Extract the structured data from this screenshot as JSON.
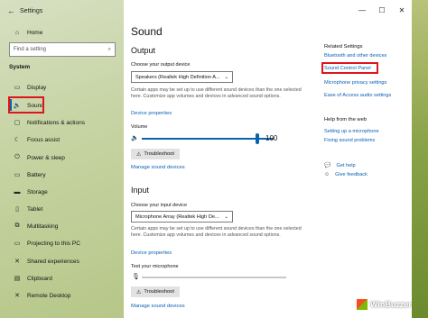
{
  "titlebar": {
    "back": "←",
    "title": "Settings"
  },
  "sidebar": {
    "home": "Home",
    "search_placeholder": "Find a setting",
    "section": "System",
    "items": [
      {
        "icon": "display-icon",
        "glyph": "▭",
        "label": "Display"
      },
      {
        "icon": "speaker-icon",
        "glyph": "🔈",
        "label": "Sound"
      },
      {
        "icon": "notifications-icon",
        "glyph": "▢",
        "label": "Notifications & actions"
      },
      {
        "icon": "focus-assist-icon",
        "glyph": "☾",
        "label": "Focus assist"
      },
      {
        "icon": "power-icon",
        "glyph": "⏻",
        "label": "Power & sleep"
      },
      {
        "icon": "battery-icon",
        "glyph": "▭",
        "label": "Battery"
      },
      {
        "icon": "storage-icon",
        "glyph": "▬",
        "label": "Storage"
      },
      {
        "icon": "tablet-icon",
        "glyph": "▯",
        "label": "Tablet"
      },
      {
        "icon": "multitasking-icon",
        "glyph": "⧉",
        "label": "Multitasking"
      },
      {
        "icon": "projecting-icon",
        "glyph": "▭",
        "label": "Projecting to this PC"
      },
      {
        "icon": "shared-experiences-icon",
        "glyph": "✕",
        "label": "Shared experiences"
      },
      {
        "icon": "clipboard-icon",
        "glyph": "▤",
        "label": "Clipboard"
      },
      {
        "icon": "remote-desktop-icon",
        "glyph": "✕",
        "label": "Remote Desktop"
      }
    ]
  },
  "main": {
    "title": "Sound",
    "output": {
      "heading": "Output",
      "choose_label": "Choose your output device",
      "device": "Speakers (Realtek High Definition A...",
      "desc": "Certain apps may be set up to use different sound devices than the one selected here. Customize app volumes and devices in advanced sound options.",
      "properties_link": "Device properties",
      "volume_label": "Volume",
      "volume_value": "100",
      "volume_level": 1.0,
      "troubleshoot": "Troubleshoot",
      "manage_link": "Manage sound devices"
    },
    "input": {
      "heading": "Input",
      "choose_label": "Choose your input device",
      "device": "Microphone Array (Realtek High De...",
      "desc": "Certain apps may be set up to use different sound devices than the one selected here. Customize app volumes and devices in advanced sound options.",
      "properties_link": "Device properties",
      "test_label": "Test your microphone",
      "troubleshoot": "Troubleshoot",
      "manage_link": "Manage sound devices"
    }
  },
  "related": {
    "heading": "Related Settings",
    "links": [
      "Bluetooth and other devices",
      "Sound Control Panel",
      "Microphone privacy settings",
      "Ease of Access audio settings"
    ]
  },
  "help": {
    "heading": "Help from the web",
    "links": [
      "Setting up a microphone",
      "Fixing sound problems"
    ],
    "get_help": "Get help",
    "feedback": "Give feedback"
  },
  "watermark": {
    "text": "WinBuzzer"
  },
  "colors": {
    "accent": "#0a64ad",
    "highlight": "#e0141e",
    "link": "#0a5fb4"
  }
}
